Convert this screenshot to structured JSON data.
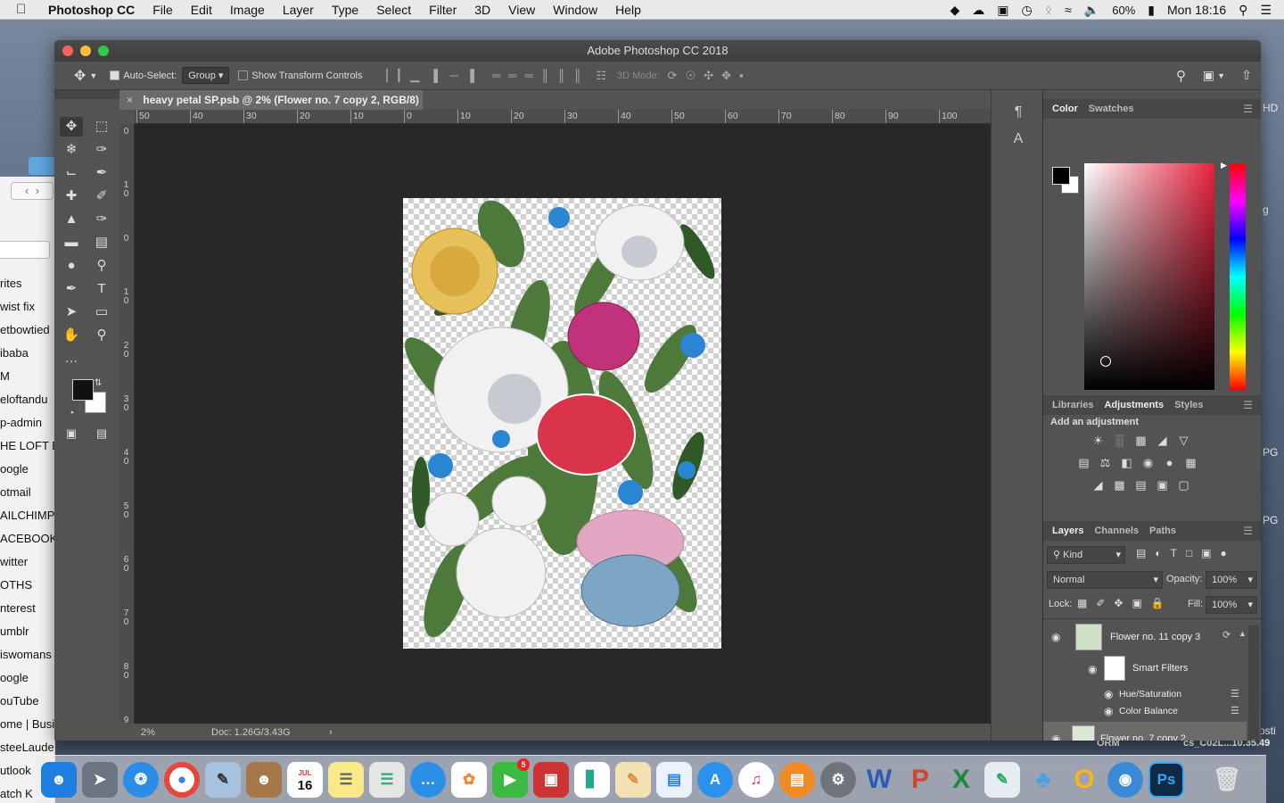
{
  "menubar": {
    "app_name": "Photoshop CC",
    "items": [
      "File",
      "Edit",
      "Image",
      "Layer",
      "Type",
      "Select",
      "Filter",
      "3D",
      "View",
      "Window",
      "Help"
    ],
    "battery": "60%",
    "clock": "Mon 18:16"
  },
  "browser_bookmarks": [
    "rites",
    "wist fix",
    "etbowtied",
    "ibaba",
    "M",
    "eloftandu",
    "p-admin",
    "HE LOFT E",
    "oogle",
    "otmail",
    "AILCHIMP",
    "ACEBOOK",
    "witter",
    "OTHS",
    "nterest",
    "umblr",
    "iswomans",
    "oogle",
    "ouTube",
    "ome | Busi",
    "steeLauder",
    "utlook",
    "atch K"
  ],
  "desktop_right_labels": [
    "HD",
    "g",
    "PG",
    "PG",
    "osti"
  ],
  "desktop_bottom_labels": {
    "left": "ORM",
    "right": "cs_C02L...10.35.49"
  },
  "window": {
    "title": "Adobe Photoshop CC 2018"
  },
  "options_bar": {
    "auto_select_label": "Auto-Select:",
    "auto_select_checked": true,
    "auto_select_value": "Group",
    "transform_controls_label": "Show Transform Controls",
    "transform_controls_checked": false,
    "mode_3d_label": "3D Mode:"
  },
  "document": {
    "tab_title": "heavy petal SP.psb @ 2% (Flower no. 7 copy 2, RGB/8)",
    "zoom": "2%",
    "doc_size": "Doc: 1.26G/3.43G"
  },
  "rulers": {
    "horizontal": [
      "50",
      "40",
      "30",
      "20",
      "10",
      "0",
      "10",
      "20",
      "30",
      "40",
      "50",
      "60",
      "70",
      "80",
      "90",
      "100"
    ],
    "vertical": [
      "0",
      "1 0",
      "0",
      "1 0",
      "2 0",
      "3 0",
      "4 0",
      "5 0",
      "6 0",
      "7 0",
      "8 0",
      "9 0"
    ]
  },
  "tools": [
    "move-tool",
    "marquee-tool",
    "lasso-tool",
    "quick-selection-tool",
    "crop-tool",
    "eyedropper-tool",
    "healing-brush-tool",
    "brush-tool",
    "clone-stamp-tool",
    "history-brush-tool",
    "eraser-tool",
    "gradient-tool",
    "blur-tool",
    "dodge-tool",
    "pen-tool",
    "type-tool",
    "path-selection-tool",
    "rectangle-tool",
    "hand-tool",
    "zoom-tool",
    "more-tools"
  ],
  "color_panel": {
    "tabs": [
      "Color",
      "Swatches"
    ],
    "active_tab": "Color",
    "foreground": "#000000",
    "background": "#ffffff",
    "field_hue": "#e8233f"
  },
  "adjustments_panel": {
    "tabs": [
      "Libraries",
      "Adjustments",
      "Styles"
    ],
    "active_tab": "Adjustments",
    "heading": "Add an adjustment"
  },
  "layers_panel": {
    "tabs": [
      "Layers",
      "Channels",
      "Paths"
    ],
    "active_tab": "Layers",
    "filter_kind": "Kind",
    "blend_mode": "Normal",
    "opacity_label": "Opacity:",
    "opacity": "100%",
    "lock_label": "Lock:",
    "fill_label": "Fill:",
    "fill": "100%",
    "layers": [
      {
        "name": "Flower no. 11 copy 3",
        "visible": true
      },
      {
        "name": "Smart Filters",
        "visible": true
      },
      {
        "name": "Hue/Saturation",
        "visible": true
      },
      {
        "name": "Color Balance",
        "visible": true
      },
      {
        "name": "Flower no. 7 copy 2",
        "visible": true,
        "selected": true
      }
    ]
  },
  "dock": {
    "calendar_month": "JUL",
    "calendar_day": "16",
    "facetime_badge": "5",
    "word_letter": "W",
    "ps_letter": "Ps"
  }
}
